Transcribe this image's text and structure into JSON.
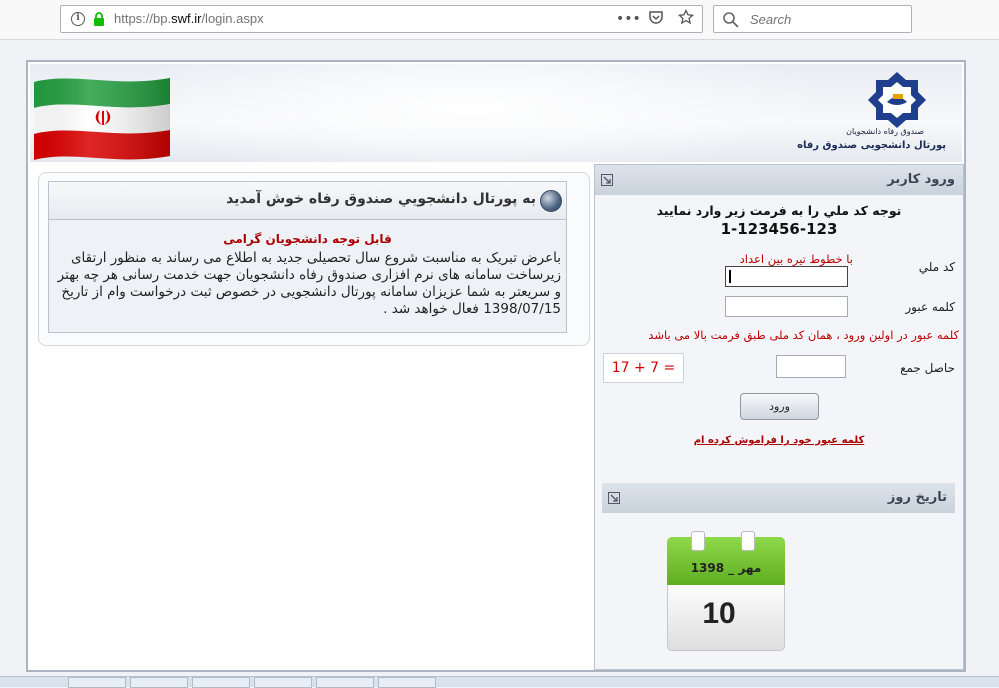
{
  "browser": {
    "url_prefix": "https://bp.",
    "url_domain": "swf.ir",
    "url_suffix": "/login.aspx",
    "menu_glyph": "•••",
    "search_placeholder": "Search"
  },
  "header": {
    "logo_caption": "صندوق رفاه دانشجویان",
    "portal_title": "پورتال دانشجویی صندوق رفاه"
  },
  "welcome": {
    "title": "به پورتال دانشجويي صندوق رفاه خوش آمدید",
    "notice_title": "قابل توجه دانشجویان گرامی",
    "notice_body": "باعرض تبریک به مناسبت شروع سال تحصیلی جدید به اطلاع می رساند به منظور ارتقای زیرساخت سامانه های نرم افزاری صندوق رفاه دانشجویان جهت خدمت رسانی هر چه بهتر و سریعتر به شما عزیزان سامانه پورتال دانشجویی در خصوص ثبت درخواست وام از تاریخ 1398/07/15 فعال خواهد شد ."
  },
  "login": {
    "panel_title": "ورود کاربر",
    "instruction": "توجه کد ملي را به فرمت زير وارد نماييد",
    "format_example": "1-123456-123",
    "hint": "با خطوط تیره بین اعداد",
    "national_code_label": "کد ملي",
    "national_code_value": "",
    "password_label": "کلمه عبور",
    "password_value": "",
    "password_warning": "کلمه عبور در اولین ورود ، همان کد ملی طبق فرمت بالا می باشد",
    "captcha_label": "حاصل جمع",
    "captcha_text": "17 + 7 =",
    "captcha_value": "",
    "submit_label": "ورود",
    "forgot_label": "کلمه عبور خود را فراموش کرده ام"
  },
  "date_panel": {
    "title": "تاریخ روز",
    "month": "مهر _ 1398",
    "day": "10"
  },
  "colors": {
    "accent_red": "#b00000",
    "calendar_green": "#6fc02e",
    "panel_header": "#d3dae3"
  }
}
